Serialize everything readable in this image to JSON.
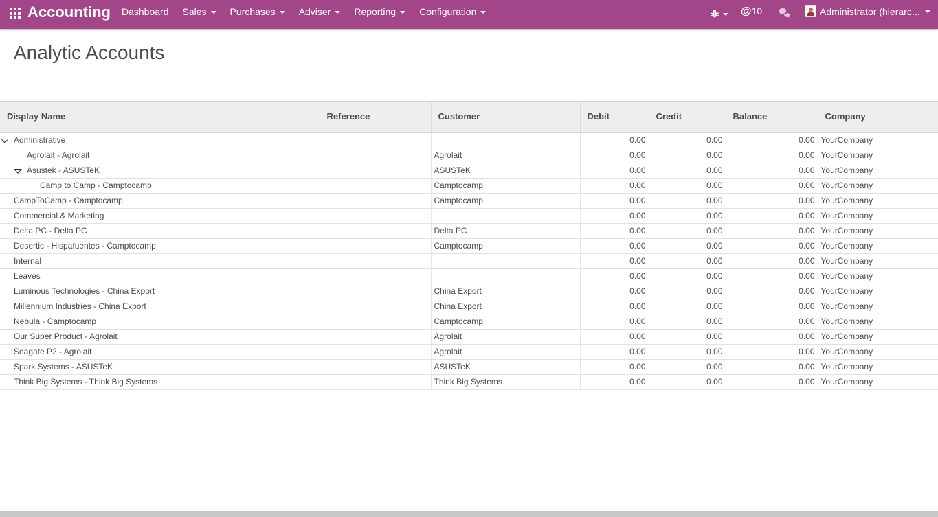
{
  "navbar": {
    "brand": "Accounting",
    "menu": [
      {
        "label": "Dashboard",
        "dropdown": false
      },
      {
        "label": "Sales",
        "dropdown": true
      },
      {
        "label": "Purchases",
        "dropdown": true
      },
      {
        "label": "Adviser",
        "dropdown": true
      },
      {
        "label": "Reporting",
        "dropdown": true
      },
      {
        "label": "Configuration",
        "dropdown": true
      }
    ],
    "mentions_count": "10",
    "mentions_at": "@",
    "user_name": "Administrator (hierarc...",
    "color": "#a24689"
  },
  "page": {
    "title": "Analytic Accounts"
  },
  "table": {
    "columns": [
      "Display Name",
      "Reference",
      "Customer",
      "Debit",
      "Credit",
      "Balance",
      "Company"
    ],
    "rows": [
      {
        "name": "Administrative",
        "level": 0,
        "expanded": true,
        "reference": "",
        "customer": "",
        "debit": "0.00",
        "credit": "0.00",
        "balance": "0.00",
        "company": "YourCompany"
      },
      {
        "name": "Agrolait - Agrolait",
        "level": 1,
        "expanded": false,
        "reference": "",
        "customer": "Agrolait",
        "debit": "0.00",
        "credit": "0.00",
        "balance": "0.00",
        "company": "YourCompany"
      },
      {
        "name": "Asustek - ASUSTeK",
        "level": 1,
        "expanded": true,
        "reference": "",
        "customer": "ASUSTeK",
        "debit": "0.00",
        "credit": "0.00",
        "balance": "0.00",
        "company": "YourCompany"
      },
      {
        "name": "Camp to Camp - Camptocamp",
        "level": 2,
        "expanded": false,
        "reference": "",
        "customer": "Camptocamp",
        "debit": "0.00",
        "credit": "0.00",
        "balance": "0.00",
        "company": "YourCompany"
      },
      {
        "name": "CampToCamp - Camptocamp",
        "level": 0,
        "expanded": false,
        "reference": "",
        "customer": "Camptocamp",
        "debit": "0.00",
        "credit": "0.00",
        "balance": "0.00",
        "company": "YourCompany"
      },
      {
        "name": "Commercial & Marketing",
        "level": 0,
        "expanded": false,
        "reference": "",
        "customer": "",
        "debit": "0.00",
        "credit": "0.00",
        "balance": "0.00",
        "company": "YourCompany"
      },
      {
        "name": "Delta PC - Delta PC",
        "level": 0,
        "expanded": false,
        "reference": "",
        "customer": "Delta PC",
        "debit": "0.00",
        "credit": "0.00",
        "balance": "0.00",
        "company": "YourCompany"
      },
      {
        "name": "Desertic - Hispafuentes - Camptocamp",
        "level": 0,
        "expanded": false,
        "reference": "",
        "customer": "Camptocamp",
        "debit": "0.00",
        "credit": "0.00",
        "balance": "0.00",
        "company": "YourCompany"
      },
      {
        "name": "Internal",
        "level": 0,
        "expanded": false,
        "reference": "",
        "customer": "",
        "debit": "0.00",
        "credit": "0.00",
        "balance": "0.00",
        "company": "YourCompany"
      },
      {
        "name": "Leaves",
        "level": 0,
        "expanded": false,
        "reference": "",
        "customer": "",
        "debit": "0.00",
        "credit": "0.00",
        "balance": "0.00",
        "company": "YourCompany"
      },
      {
        "name": "Luminous Technologies - China Export",
        "level": 0,
        "expanded": false,
        "reference": "",
        "customer": "China Export",
        "debit": "0.00",
        "credit": "0.00",
        "balance": "0.00",
        "company": "YourCompany"
      },
      {
        "name": "Millennium Industries - China Export",
        "level": 0,
        "expanded": false,
        "reference": "",
        "customer": "China Export",
        "debit": "0.00",
        "credit": "0.00",
        "balance": "0.00",
        "company": "YourCompany"
      },
      {
        "name": "Nebula - Camptocamp",
        "level": 0,
        "expanded": false,
        "reference": "",
        "customer": "Camptocamp",
        "debit": "0.00",
        "credit": "0.00",
        "balance": "0.00",
        "company": "YourCompany"
      },
      {
        "name": "Our Super Product - Agrolait",
        "level": 0,
        "expanded": false,
        "reference": "",
        "customer": "Agrolait",
        "debit": "0.00",
        "credit": "0.00",
        "balance": "0.00",
        "company": "YourCompany"
      },
      {
        "name": "Seagate P2 - Agrolait",
        "level": 0,
        "expanded": false,
        "reference": "",
        "customer": "Agrolait",
        "debit": "0.00",
        "credit": "0.00",
        "balance": "0.00",
        "company": "YourCompany"
      },
      {
        "name": "Spark Systems - ASUSTeK",
        "level": 0,
        "expanded": false,
        "reference": "",
        "customer": "ASUSTeK",
        "debit": "0.00",
        "credit": "0.00",
        "balance": "0.00",
        "company": "YourCompany"
      },
      {
        "name": "Think Big Systems - Think Big Systems",
        "level": 0,
        "expanded": false,
        "reference": "",
        "customer": "Think Big Systems",
        "debit": "0.00",
        "credit": "0.00",
        "balance": "0.00",
        "company": "YourCompany"
      }
    ]
  }
}
